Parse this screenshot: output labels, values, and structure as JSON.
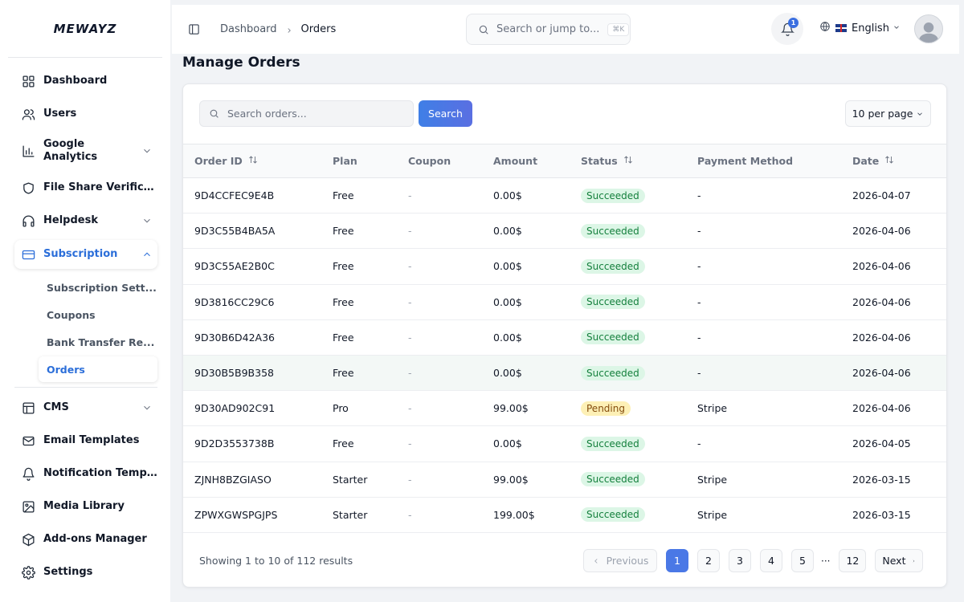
{
  "app": {
    "logo": "MEWAYZ"
  },
  "sidebar": {
    "items": [
      {
        "key": "dashboard",
        "label": "Dashboard",
        "icon": "grid-icon"
      },
      {
        "key": "users",
        "label": "Users",
        "icon": "users-icon"
      },
      {
        "key": "google-analytics",
        "label": "Google Analytics",
        "icon": "bar-chart-icon",
        "expandable": true
      },
      {
        "key": "file-share",
        "label": "File Share Verifica...",
        "icon": "shield-icon"
      },
      {
        "key": "helpdesk",
        "label": "Helpdesk",
        "icon": "headphones-icon",
        "expandable": true
      },
      {
        "key": "subscription",
        "label": "Subscription",
        "icon": "credit-card-icon",
        "expandable": true,
        "active": true
      },
      {
        "key": "cms",
        "label": "CMS",
        "icon": "layout-icon",
        "expandable": true
      },
      {
        "key": "email-templates",
        "label": "Email Templates",
        "icon": "mail-icon"
      },
      {
        "key": "notification-templates",
        "label": "Notification Templ...",
        "icon": "bell-icon"
      },
      {
        "key": "media-library",
        "label": "Media Library",
        "icon": "image-icon"
      },
      {
        "key": "addons",
        "label": "Add-ons Manager",
        "icon": "package-icon"
      },
      {
        "key": "settings",
        "label": "Settings",
        "icon": "gear-icon"
      }
    ],
    "subscription_children": [
      {
        "label": "Subscription Sett..."
      },
      {
        "label": "Coupons"
      },
      {
        "label": "Bank Transfer Re..."
      },
      {
        "label": "Orders",
        "active": true
      }
    ]
  },
  "header": {
    "breadcrumb": [
      "Dashboard",
      "Orders"
    ],
    "search_placeholder": "Search or jump to...",
    "search_shortcut": "⌘K",
    "notification_count": "1",
    "language": "English"
  },
  "main": {
    "title": "Manage Orders",
    "search_placeholder": "Search orders...",
    "search_button": "Search",
    "per_page": "10 per page",
    "columns": [
      "Order ID",
      "Plan",
      "Coupon",
      "Amount",
      "Status",
      "Payment Method",
      "Date"
    ],
    "rows": [
      {
        "id": "9D4CCFEC9E4B",
        "plan": "Free",
        "coupon": "-",
        "amount": "0.00$",
        "status": "Succeeded",
        "method": "-",
        "date": "2026-04-07"
      },
      {
        "id": "9D3C55B4BA5A",
        "plan": "Free",
        "coupon": "-",
        "amount": "0.00$",
        "status": "Succeeded",
        "method": "-",
        "date": "2026-04-06"
      },
      {
        "id": "9D3C55AE2B0C",
        "plan": "Free",
        "coupon": "-",
        "amount": "0.00$",
        "status": "Succeeded",
        "method": "-",
        "date": "2026-04-06"
      },
      {
        "id": "9D3816CC29C6",
        "plan": "Free",
        "coupon": "-",
        "amount": "0.00$",
        "status": "Succeeded",
        "method": "-",
        "date": "2026-04-06"
      },
      {
        "id": "9D30B6D42A36",
        "plan": "Free",
        "coupon": "-",
        "amount": "0.00$",
        "status": "Succeeded",
        "method": "-",
        "date": "2026-04-06"
      },
      {
        "id": "9D30B5B9B358",
        "plan": "Free",
        "coupon": "-",
        "amount": "0.00$",
        "status": "Succeeded",
        "method": "-",
        "date": "2026-04-06"
      },
      {
        "id": "9D30AD902C91",
        "plan": "Pro",
        "coupon": "-",
        "amount": "99.00$",
        "status": "Pending",
        "method": "Stripe",
        "date": "2026-04-06"
      },
      {
        "id": "9D2D3553738B",
        "plan": "Free",
        "coupon": "-",
        "amount": "0.00$",
        "status": "Succeeded",
        "method": "-",
        "date": "2026-04-05"
      },
      {
        "id": "ZJNH8BZGIASO",
        "plan": "Starter",
        "coupon": "-",
        "amount": "99.00$",
        "status": "Succeeded",
        "method": "Stripe",
        "date": "2026-03-15"
      },
      {
        "id": "ZPWXGWSPGJPS",
        "plan": "Starter",
        "coupon": "-",
        "amount": "199.00$",
        "status": "Succeeded",
        "method": "Stripe",
        "date": "2026-03-15"
      }
    ],
    "footer_text": "Showing 1 to 10 of 112 results",
    "pagination": {
      "previous": "Previous",
      "next": "Next",
      "pages": [
        "1",
        "2",
        "3",
        "4",
        "5"
      ],
      "ellipsis": "···",
      "last": "12",
      "current": "1"
    }
  }
}
